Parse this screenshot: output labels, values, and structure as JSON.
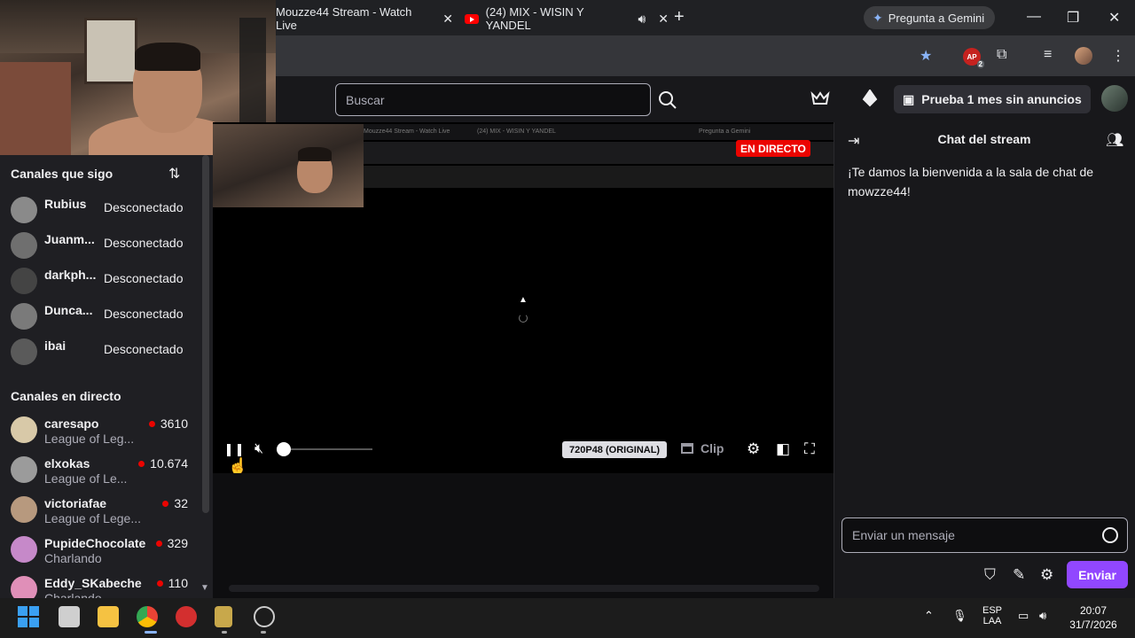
{
  "browser": {
    "tabs": [
      {
        "title": "Mouzze44 Stream - Watch Live",
        "close": "✕"
      },
      {
        "title": "(24) MIX - WISIN Y YANDEL",
        "close": "✕",
        "audio_icon": "speaker-icon"
      }
    ],
    "new_tab": "+",
    "gemini_label": "Pregunta a Gemini",
    "window_controls": {
      "minimize": "—",
      "restore": "❐",
      "close": "✕"
    },
    "extension_badge": "AP",
    "extension_count": "2"
  },
  "twitch": {
    "search_placeholder": "Buscar",
    "prime_button": "Prueba 1 mes sin anuncios"
  },
  "sidebar": {
    "followed_heading": "Canales que sigo",
    "followed": [
      {
        "name": "Rubius",
        "status": "Desconectado"
      },
      {
        "name": "Juanm...",
        "status": "Desconectado"
      },
      {
        "name": "darkph...",
        "status": "Desconectado"
      },
      {
        "name": "Dunca...",
        "status": "Desconectado"
      },
      {
        "name": "ibai",
        "status": "Desconectado"
      }
    ],
    "live_heading": "Canales en directo",
    "live": [
      {
        "name": "caresapo",
        "game": "League of Leg...",
        "viewers": "3610"
      },
      {
        "name": "elxokas",
        "game": "League of Le...",
        "viewers": "10.674"
      },
      {
        "name": "victoriafae",
        "game": "League of Lege...",
        "viewers": "32"
      },
      {
        "name": "PupideChocolate",
        "game": "Charlando",
        "viewers": "329"
      },
      {
        "name": "Eddy_SKabeche",
        "game": "Charlando",
        "viewers": "110"
      }
    ]
  },
  "player": {
    "live_badge": "EN DIRECTO",
    "quality": "720P48 (ORIGINAL)",
    "clip_label": "Clip",
    "volume_level": 0,
    "inner_tab1": "Mouzze44 Stream - Watch Live",
    "inner_tab2": "(24) MIX - WISIN Y YANDEL",
    "inner_gemini": "Pregunta a Gemini"
  },
  "chat": {
    "title": "Chat del stream",
    "welcome": "¡Te damos la bienvenida a la sala de chat de mowzze44!",
    "input_placeholder": "Enviar un mensaje",
    "send_label": "Enviar"
  },
  "taskbar": {
    "lang_top": "ESP",
    "lang_bottom": "LAA",
    "time": "20:07",
    "date": "31/7/2026"
  },
  "colors": {
    "accent": "#9147ff",
    "live_red": "#eb0400",
    "bg": "#0e0e10",
    "sidebar": "#1f1f23"
  }
}
